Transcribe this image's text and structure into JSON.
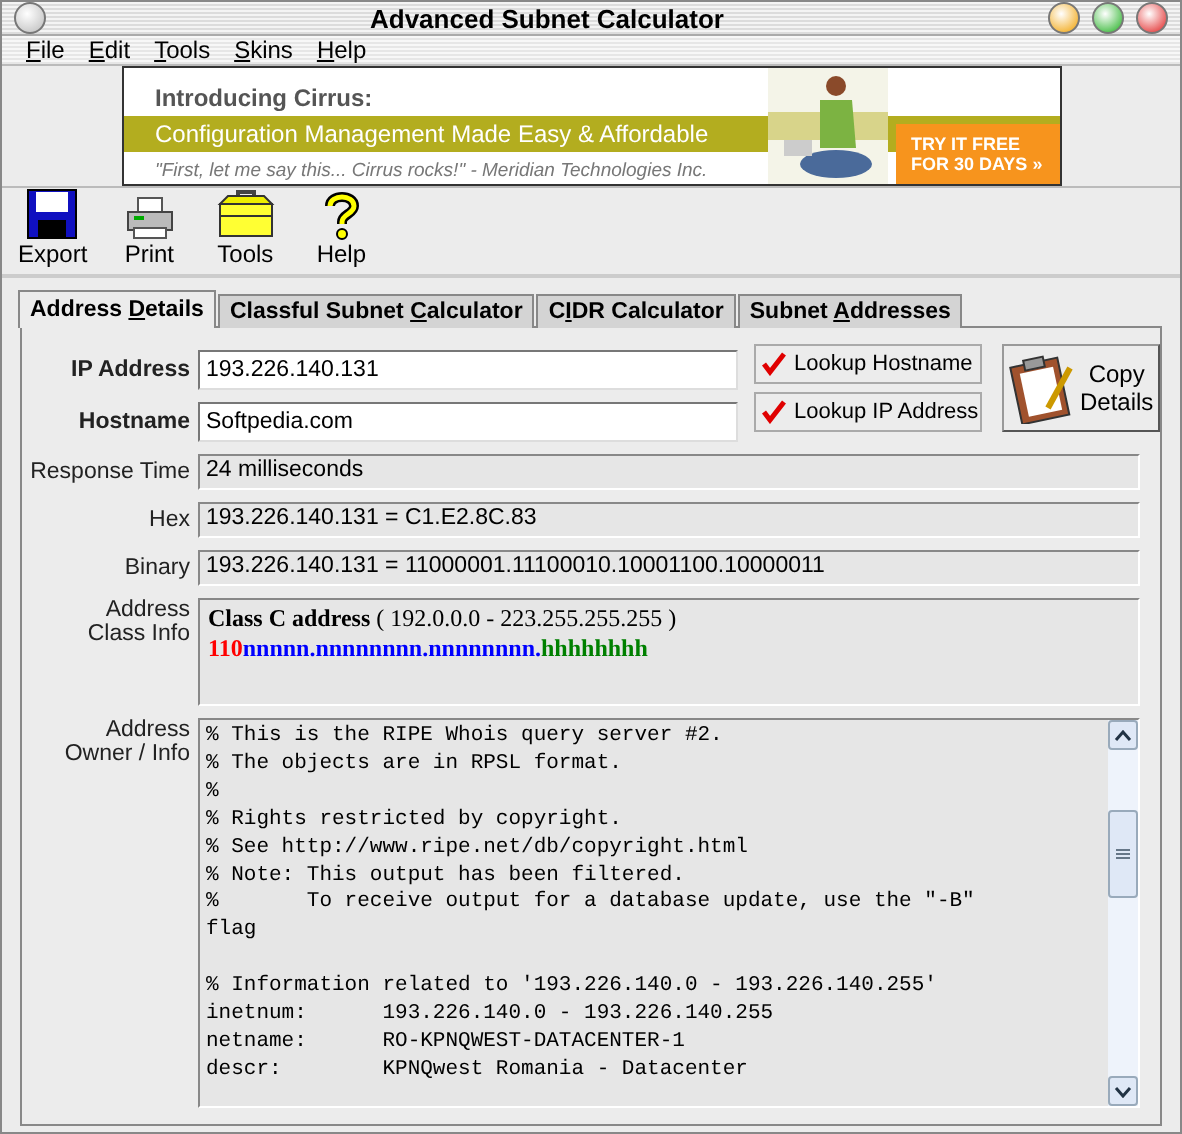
{
  "window": {
    "title": "Advanced Subnet Calculator"
  },
  "menu": [
    {
      "key": "F",
      "rest": "ile"
    },
    {
      "key": "E",
      "rest": "dit"
    },
    {
      "key": "T",
      "rest": "ools"
    },
    {
      "key": "S",
      "rest": "kins"
    },
    {
      "key": "H",
      "rest": "elp"
    }
  ],
  "banner": {
    "headline": "Introducing Cirrus:",
    "tagline": "Configuration Management Made Easy & Affordable",
    "quote": "\"First, let me say this... Cirrus rocks!\" - Meridian Technologies Inc.",
    "offer_lines": [
      "TRY IT FREE",
      "FOR 30 DAYS »"
    ]
  },
  "toolbar": [
    {
      "label": "Export",
      "kind": "disk"
    },
    {
      "label": "Print",
      "kind": "printer"
    },
    {
      "label": "Tools",
      "kind": "toolbox"
    },
    {
      "label": "Help",
      "kind": "question"
    }
  ],
  "tabs": [
    {
      "before": "Address ",
      "key": "D",
      "rest": "etails",
      "selected": true
    },
    {
      "before": "Classful Subnet ",
      "key": "C",
      "rest": "alculator",
      "selected": false
    },
    {
      "before": "C",
      "key": "I",
      "rest": "DR Calculator",
      "selected": false
    },
    {
      "before": "Subnet ",
      "key": "A",
      "rest": "ddresses",
      "selected": false
    }
  ],
  "ip_address": {
    "label": "IP Address",
    "value": "193.226.140.131"
  },
  "hostname": {
    "label": "Hostname",
    "value": "Softpedia.com"
  },
  "lookups": [
    {
      "label": "Lookup Hostname",
      "checked": true
    },
    {
      "label": "Lookup IP Address",
      "checked": true
    }
  ],
  "copy_button": {
    "label_lines": [
      "Copy",
      "Details"
    ]
  },
  "readouts": [
    {
      "label": "Response Time",
      "value": "24 milliseconds"
    },
    {
      "label": "Hex",
      "value": "193.226.140.131 = C1.E2.8C.83"
    },
    {
      "label": "Binary",
      "value": "193.226.140.131 = 11000001.11100010.10001100.10000011"
    }
  ],
  "class_info": {
    "label_lines": [
      "Address",
      "Class Info"
    ],
    "title": "**Class C address** ( 192.0.0.0 - 223.255.255.255 )",
    "bits": [
      {
        "text": "110",
        "color": "#ff0000"
      },
      {
        "text": "nnnnn.nnnnnnnn.nnnnnnnn.",
        "color": "#0000ff"
      },
      {
        "text": "hhhhhhhh",
        "color": "#008000"
      }
    ]
  },
  "owner_info": {
    "label_lines": [
      "Address",
      "Owner / Info"
    ],
    "paragraphs": [
      [
        "% This is the RIPE Whois query server #2.",
        "% The objects are in RPSL format.",
        "%",
        "% Rights restricted by copyright.",
        "% See http://www.ripe.net/db/copyright.html",
        "% Note: This output has been filtered.",
        "%       To receive output for a database update, use the \"-B\"",
        "flag"
      ],
      [
        "% Information related to '193.226.140.0 - 193.226.140.255'",
        "inetnum:      193.226.140.0 - 193.226.140.255",
        "netname:      RO-KPNQWEST-DATACENTER-1",
        "descr:        KPNQwest Romania - Datacenter"
      ]
    ]
  }
}
